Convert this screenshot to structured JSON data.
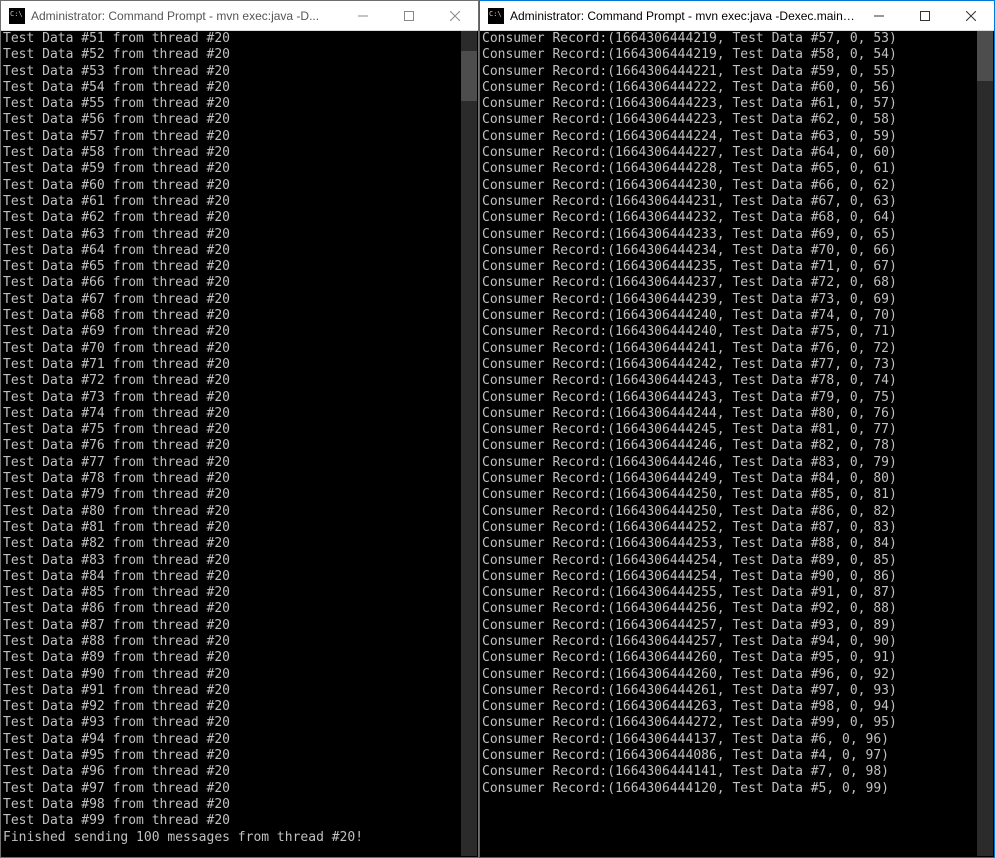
{
  "left_window": {
    "title": "Administrator: Command Prompt - mvn  exec:java -D...",
    "lines": [
      "Test Data #51 from thread #20",
      "Test Data #52 from thread #20",
      "Test Data #53 from thread #20",
      "Test Data #54 from thread #20",
      "Test Data #55 from thread #20",
      "Test Data #56 from thread #20",
      "Test Data #57 from thread #20",
      "Test Data #58 from thread #20",
      "Test Data #59 from thread #20",
      "Test Data #60 from thread #20",
      "Test Data #61 from thread #20",
      "Test Data #62 from thread #20",
      "Test Data #63 from thread #20",
      "Test Data #64 from thread #20",
      "Test Data #65 from thread #20",
      "Test Data #66 from thread #20",
      "Test Data #67 from thread #20",
      "Test Data #68 from thread #20",
      "Test Data #69 from thread #20",
      "Test Data #70 from thread #20",
      "Test Data #71 from thread #20",
      "Test Data #72 from thread #20",
      "Test Data #73 from thread #20",
      "Test Data #74 from thread #20",
      "Test Data #75 from thread #20",
      "Test Data #76 from thread #20",
      "Test Data #77 from thread #20",
      "Test Data #78 from thread #20",
      "Test Data #79 from thread #20",
      "Test Data #80 from thread #20",
      "Test Data #81 from thread #20",
      "Test Data #82 from thread #20",
      "Test Data #83 from thread #20",
      "Test Data #84 from thread #20",
      "Test Data #85 from thread #20",
      "Test Data #86 from thread #20",
      "Test Data #87 from thread #20",
      "Test Data #88 from thread #20",
      "Test Data #89 from thread #20",
      "Test Data #90 from thread #20",
      "Test Data #91 from thread #20",
      "Test Data #92 from thread #20",
      "Test Data #93 from thread #20",
      "Test Data #94 from thread #20",
      "Test Data #95 from thread #20",
      "Test Data #96 from thread #20",
      "Test Data #97 from thread #20",
      "Test Data #98 from thread #20",
      "Test Data #99 from thread #20",
      "Finished sending 100 messages from thread #20!"
    ]
  },
  "right_window": {
    "title": "Administrator: Command Prompt - mvn  exec:java -Dexec.mainC...",
    "lines": [
      "Consumer Record:(1664306444219, Test Data #57, 0, 53)",
      "Consumer Record:(1664306444219, Test Data #58, 0, 54)",
      "Consumer Record:(1664306444221, Test Data #59, 0, 55)",
      "Consumer Record:(1664306444222, Test Data #60, 0, 56)",
      "Consumer Record:(1664306444223, Test Data #61, 0, 57)",
      "Consumer Record:(1664306444223, Test Data #62, 0, 58)",
      "Consumer Record:(1664306444224, Test Data #63, 0, 59)",
      "Consumer Record:(1664306444227, Test Data #64, 0, 60)",
      "Consumer Record:(1664306444228, Test Data #65, 0, 61)",
      "Consumer Record:(1664306444230, Test Data #66, 0, 62)",
      "Consumer Record:(1664306444231, Test Data #67, 0, 63)",
      "Consumer Record:(1664306444232, Test Data #68, 0, 64)",
      "Consumer Record:(1664306444233, Test Data #69, 0, 65)",
      "Consumer Record:(1664306444234, Test Data #70, 0, 66)",
      "Consumer Record:(1664306444235, Test Data #71, 0, 67)",
      "Consumer Record:(1664306444237, Test Data #72, 0, 68)",
      "Consumer Record:(1664306444239, Test Data #73, 0, 69)",
      "Consumer Record:(1664306444240, Test Data #74, 0, 70)",
      "Consumer Record:(1664306444240, Test Data #75, 0, 71)",
      "Consumer Record:(1664306444241, Test Data #76, 0, 72)",
      "Consumer Record:(1664306444242, Test Data #77, 0, 73)",
      "Consumer Record:(1664306444243, Test Data #78, 0, 74)",
      "Consumer Record:(1664306444243, Test Data #79, 0, 75)",
      "Consumer Record:(1664306444244, Test Data #80, 0, 76)",
      "Consumer Record:(1664306444245, Test Data #81, 0, 77)",
      "Consumer Record:(1664306444246, Test Data #82, 0, 78)",
      "Consumer Record:(1664306444246, Test Data #83, 0, 79)",
      "Consumer Record:(1664306444249, Test Data #84, 0, 80)",
      "Consumer Record:(1664306444250, Test Data #85, 0, 81)",
      "Consumer Record:(1664306444250, Test Data #86, 0, 82)",
      "Consumer Record:(1664306444252, Test Data #87, 0, 83)",
      "Consumer Record:(1664306444253, Test Data #88, 0, 84)",
      "Consumer Record:(1664306444254, Test Data #89, 0, 85)",
      "Consumer Record:(1664306444254, Test Data #90, 0, 86)",
      "Consumer Record:(1664306444255, Test Data #91, 0, 87)",
      "Consumer Record:(1664306444256, Test Data #92, 0, 88)",
      "Consumer Record:(1664306444257, Test Data #93, 0, 89)",
      "Consumer Record:(1664306444257, Test Data #94, 0, 90)",
      "Consumer Record:(1664306444260, Test Data #95, 0, 91)",
      "Consumer Record:(1664306444260, Test Data #96, 0, 92)",
      "Consumer Record:(1664306444261, Test Data #97, 0, 93)",
      "Consumer Record:(1664306444263, Test Data #98, 0, 94)",
      "Consumer Record:(1664306444272, Test Data #99, 0, 95)",
      "Consumer Record:(1664306444137, Test Data #6, 0, 96)",
      "Consumer Record:(1664306444086, Test Data #4, 0, 97)",
      "Consumer Record:(1664306444141, Test Data #7, 0, 98)",
      "Consumer Record:(1664306444120, Test Data #5, 0, 99)"
    ]
  }
}
